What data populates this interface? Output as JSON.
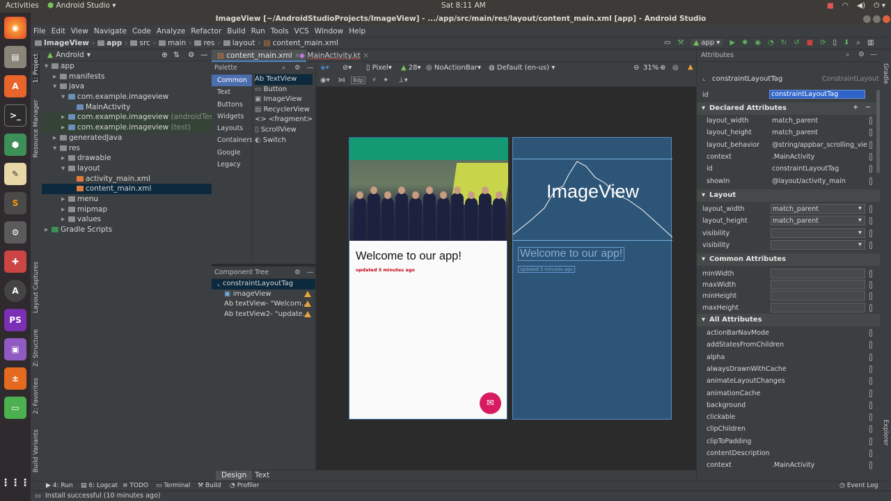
{
  "system_bar": {
    "activities": "Activities",
    "app_name": "Android Studio",
    "clock": "Sat   8:11 AM"
  },
  "window": {
    "title": "ImageView [~/AndroidStudioProjects/ImageView] - .../app/src/main/res/layout/content_main.xml [app] - Android Studio"
  },
  "menu": [
    "File",
    "Edit",
    "View",
    "Navigate",
    "Code",
    "Analyze",
    "Refactor",
    "Build",
    "Run",
    "Tools",
    "VCS",
    "Window",
    "Help"
  ],
  "breadcrumb": [
    "ImageView",
    "app",
    "src",
    "main",
    "res",
    "layout",
    "content_main.xml"
  ],
  "toolbar": {
    "run_config": "app"
  },
  "left_strip": {
    "project": "1: Project",
    "resource_manager": "Resource Manager",
    "layout_captures": "Layout Captures",
    "structure": "Z: Structure",
    "favorites": "2: Favorites",
    "build_variants": "Build Variants"
  },
  "project_panel": {
    "view_mode": "Android",
    "tree": [
      {
        "label": "app",
        "level": 0,
        "suffix": ""
      },
      {
        "label": "manifests",
        "level": 1,
        "suffix": ""
      },
      {
        "label": "java",
        "level": 1,
        "suffix": ""
      },
      {
        "label": "com.example.imageview",
        "level": 2,
        "suffix": ""
      },
      {
        "label": "MainActivity",
        "level": 3,
        "suffix": ""
      },
      {
        "label": "com.example.imageview",
        "level": 2,
        "suffix": " (androidTest)"
      },
      {
        "label": "com.example.imageview",
        "level": 2,
        "suffix": " (test)"
      },
      {
        "label": "generatedJava",
        "level": 1,
        "suffix": ""
      },
      {
        "label": "res",
        "level": 1,
        "suffix": ""
      },
      {
        "label": "drawable",
        "level": 2,
        "suffix": ""
      },
      {
        "label": "layout",
        "level": 2,
        "suffix": ""
      },
      {
        "label": "activity_main.xml",
        "level": 3,
        "suffix": ""
      },
      {
        "label": "content_main.xml",
        "level": 3,
        "suffix": ""
      },
      {
        "label": "menu",
        "level": 2,
        "suffix": ""
      },
      {
        "label": "mipmap",
        "level": 2,
        "suffix": ""
      },
      {
        "label": "values",
        "level": 2,
        "suffix": ""
      },
      {
        "label": "Gradle Scripts",
        "level": 0,
        "suffix": ""
      }
    ]
  },
  "editor_tabs": [
    {
      "label": "content_main.xml",
      "active": true
    },
    {
      "label": "MainActivity.kt",
      "active": false
    }
  ],
  "palette": {
    "title": "Palette",
    "categories": [
      "Common",
      "Text",
      "Buttons",
      "Widgets",
      "Layouts",
      "Containers",
      "Google",
      "Legacy"
    ],
    "items": [
      "Ab TextView",
      "Button",
      "ImageView",
      "RecyclerView",
      "<> <fragment>",
      "ScrollView",
      "Switch"
    ]
  },
  "design_toolbar": {
    "device": "Pixel",
    "api": "28",
    "theme": "NoActionBar",
    "locale": "Default (en-us)",
    "zoom": "31%",
    "margin": "8dp"
  },
  "component_tree": {
    "title": "Component Tree",
    "items": [
      {
        "label": "constraintLayoutTag",
        "level": 0,
        "warn": false
      },
      {
        "label": "imageView",
        "level": 1,
        "warn": true
      },
      {
        "label": "Ab textView- \"Welcom...",
        "level": 1,
        "warn": true
      },
      {
        "label": "Ab textView2- \"update...",
        "level": 1,
        "warn": true
      }
    ]
  },
  "preview": {
    "welcome": "Welcome to our app!",
    "updated": "updated 5 minutes ago",
    "blueprint_image_label": "ImageView"
  },
  "bottom_tabs": [
    "Design",
    "Text"
  ],
  "attributes": {
    "title": "Attributes",
    "component": "constraintLayoutTag",
    "component_type": "ConstraintLayout",
    "id_label": "id",
    "id_value": "constraintLayoutTag",
    "sections": {
      "declared": "Declared Attributes",
      "layout": "Layout",
      "common": "Common Attributes",
      "all": "All Attributes"
    },
    "declared_rows": [
      {
        "name": "layout_width",
        "value": "match_parent"
      },
      {
        "name": "layout_height",
        "value": "match_parent"
      },
      {
        "name": "layout_behavior",
        "value": "@string/appbar_scrolling_vie"
      },
      {
        "name": "context",
        "value": ".MainActivity"
      },
      {
        "name": "id",
        "value": "constraintLayoutTag"
      },
      {
        "name": "showIn",
        "value": "@layout/activity_main"
      }
    ],
    "layout_rows": [
      {
        "name": "layout_width",
        "value": "match_parent"
      },
      {
        "name": "layout_height",
        "value": "match_parent"
      },
      {
        "name": "visibility",
        "value": ""
      },
      {
        "name": "visibility",
        "value": ""
      }
    ],
    "common_rows": [
      "minWidth",
      "maxWidth",
      "minHeight",
      "maxHeight"
    ],
    "all_rows": [
      {
        "name": "actionBarNavMode",
        "value": ""
      },
      {
        "name": "addStatesFromChildren",
        "value": ""
      },
      {
        "name": "alpha",
        "value": ""
      },
      {
        "name": "alwaysDrawnWithCache",
        "value": ""
      },
      {
        "name": "animateLayoutChanges",
        "value": ""
      },
      {
        "name": "animationCache",
        "value": ""
      },
      {
        "name": "background",
        "value": ""
      },
      {
        "name": "clickable",
        "value": ""
      },
      {
        "name": "clipChildren",
        "value": ""
      },
      {
        "name": "clipToPadding",
        "value": ""
      },
      {
        "name": "contentDescription",
        "value": ""
      },
      {
        "name": "context",
        "value": ".MainActivity"
      }
    ]
  },
  "right_strip": {
    "gradle": "Gradle",
    "device_file_explorer": "Device File Explorer"
  },
  "tool_windows": [
    "4: Run",
    "6: Logcat",
    "TODO",
    "Terminal",
    "Build",
    "Profiler"
  ],
  "event_log": "Event Log",
  "status": "Install successful (10 minutes ago)",
  "colors": {
    "app_bar": "#149a73",
    "fab": "#d81b60",
    "blueprint": "#2d5577",
    "selection": "#0d293e",
    "accent": "#4b6eaf"
  }
}
